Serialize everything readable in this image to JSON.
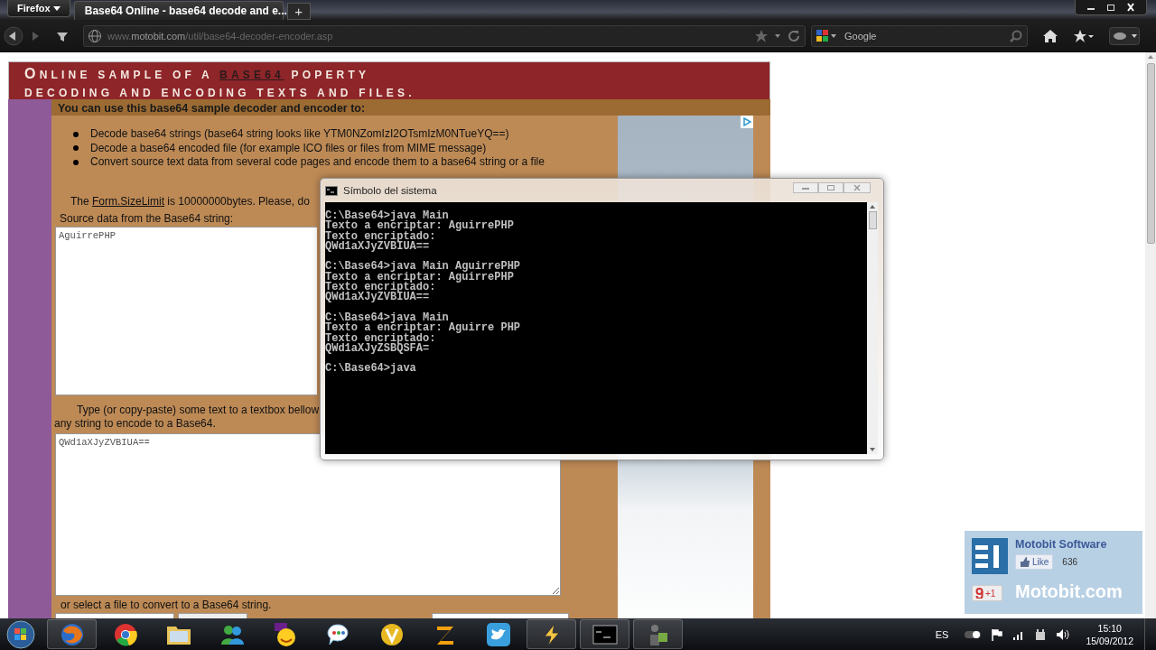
{
  "browser": {
    "menu_button": "Firefox",
    "tabs": [
      {
        "title": "Base64 Online - base64 decode and e...",
        "selected": true
      }
    ],
    "new_tab": "+",
    "url": {
      "prefix": "www.",
      "domain": "motobit.com",
      "path": "/util/base64-decoder-encoder.asp"
    },
    "search": {
      "placeholder": "Google"
    }
  },
  "page": {
    "title": {
      "before": "ONLINE SAMPLE OF A ",
      "link": "BASE64",
      "after": " POPERTY"
    },
    "subtitle": "DECODING AND ENCODING TEXTS AND FILES.",
    "intro": "You can use this base64 sample decoder and encoder to:",
    "bullets": [
      "Decode base64 strings (base64 string looks like YTM0NZomIzI2OTsmIzM0NTueYQ==)",
      "Decode a base64 encoded file (for example ICO files or files from MIME message)",
      "Convert source text data from several code pages and encode them to a base64 string or a file"
    ],
    "limit": {
      "before": "The ",
      "link": "Form.SizeLimit",
      "after": " is 10000000bytes. Please, do"
    },
    "source_label": "Source data from the Base64 string:",
    "source_value": "AguirrePHP",
    "type_label": {
      "line1": "Type (or copy-paste) some text to a textbox bellow",
      "line2": "any string to encode to a Base64."
    },
    "encode_value": "QWd1aXJyZVBIUA==",
    "file_label": "or select a file to convert to a Base64 string."
  },
  "console": {
    "title": "Símbolo del sistema",
    "blocks": [
      [
        "C:\\Base64>java Main",
        "Texto a encriptar: AguirrePHP",
        "Texto encriptado:",
        "QWd1aXJyZVBIUA=="
      ],
      [
        "C:\\Base64>java Main AguirrePHP",
        "Texto a encriptar: AguirrePHP",
        "Texto encriptado:",
        "QWd1aXJyZVBIUA=="
      ],
      [
        "C:\\Base64>java Main",
        "Texto a encriptar: Aguirre PHP",
        "Texto encriptado:",
        "QWd1aXJyZSBQSFA="
      ],
      [
        "C:\\Base64>java"
      ]
    ]
  },
  "social": {
    "name": "Motobit Software",
    "like": "Like",
    "likes": "636",
    "plus": "+1",
    "site": "Motobit.com"
  },
  "taskbar": {
    "apps": [
      {
        "kind": "firefox",
        "running": true
      },
      {
        "kind": "chrome",
        "running": false
      },
      {
        "kind": "folder",
        "running": false
      },
      {
        "kind": "messenger",
        "running": false
      },
      {
        "kind": "yahoo",
        "running": false
      },
      {
        "kind": "talk",
        "running": false
      },
      {
        "kind": "vlogo",
        "running": false
      },
      {
        "kind": "zlogo",
        "running": false
      },
      {
        "kind": "twitter",
        "running": false
      },
      {
        "kind": "winamp",
        "running": true
      },
      {
        "kind": "console",
        "running": true
      },
      {
        "kind": "figure",
        "running": true
      }
    ],
    "language": "ES",
    "time": "15:10",
    "date": "15/09/2012"
  }
}
